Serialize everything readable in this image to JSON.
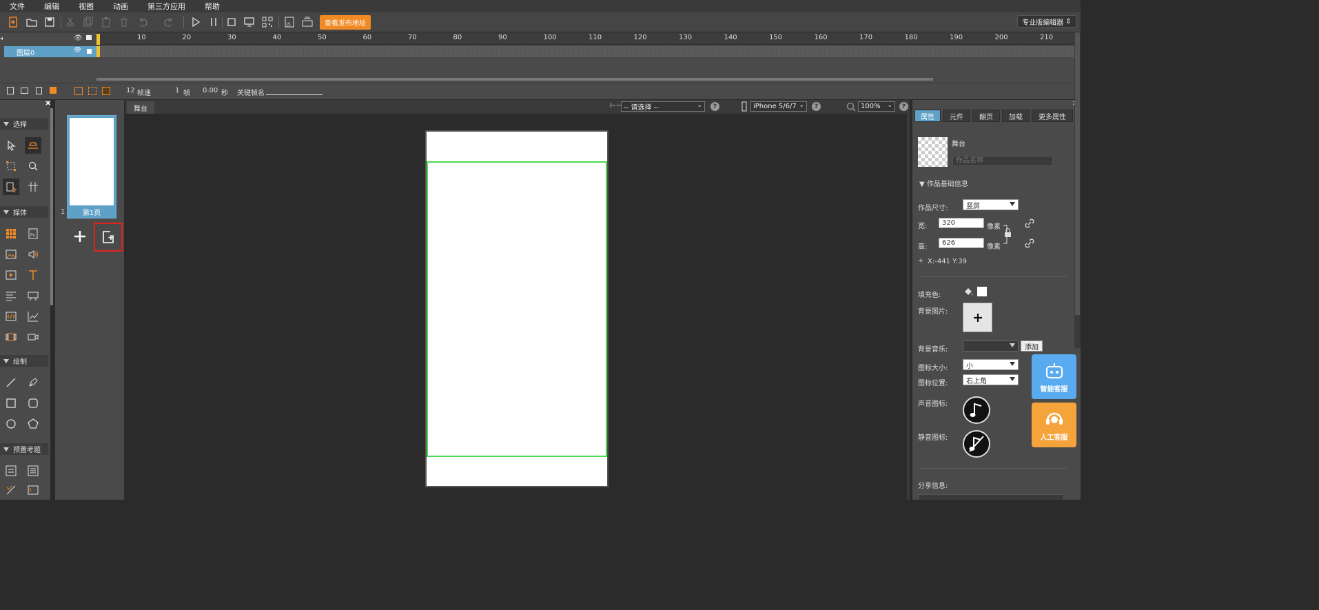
{
  "menu": [
    "文件",
    "编辑",
    "视图",
    "动画",
    "第三方应用",
    "帮助"
  ],
  "toolbar": {
    "publish_label": "查看发布地址",
    "editor_mode": "专业版编辑器"
  },
  "timeline": {
    "ruler_labels": [
      "10",
      "20",
      "30",
      "40",
      "50",
      "60",
      "70",
      "80",
      "90",
      "100",
      "110",
      "120",
      "130",
      "140",
      "150",
      "160",
      "170",
      "180",
      "190",
      "200",
      "210"
    ],
    "layer_name": "图层0",
    "fps_value": "12",
    "fps_label": "帧速",
    "frame_value": "1",
    "frame_label": "帧",
    "time_value": "0.00",
    "time_label": "秒",
    "keyframe_label": "关键帧名"
  },
  "tools": {
    "select_section": "选择",
    "media_section": "媒体",
    "draw_section": "绘制",
    "preset_section": "预置考题"
  },
  "pages": {
    "page_number": "1",
    "page_label": "第1页"
  },
  "stage": {
    "tab_label": "舞台",
    "align_select": "-- 请选择 --",
    "device_select": "iPhone 5/6/7",
    "zoom_select": "100%",
    "help": "?"
  },
  "props": {
    "tabs": [
      "属性",
      "元件",
      "翻页",
      "加载",
      "更多属性"
    ],
    "stage_title": "舞台",
    "name_placeholder": "作品名称",
    "basic_info": "作品基础信息",
    "size_label": "作品尺寸:",
    "size_value": "竖屏",
    "width_label": "宽:",
    "width_value": "320",
    "height_label": "高:",
    "height_value": "626",
    "unit": "像素",
    "coords": "X:-441    Y:39",
    "fill_label": "填充色:",
    "bg_image_label": "背景图片:",
    "bg_music_label": "背景音乐:",
    "add_label": "添加",
    "icon_size_label": "图标大小:",
    "icon_size_value": "小",
    "icon_pos_label": "图标位置:",
    "icon_pos_value": "右上角",
    "sound_icon_label": "声音图标:",
    "mute_icon_label": "静音图标:",
    "share_label": "分享信息:"
  },
  "support": {
    "smart": "智能客服",
    "human": "人工客服"
  },
  "colors": {
    "accent": "#f08a24",
    "selection": "#5fa0c7",
    "safe_zone": "#4cd84c",
    "highlight": "#e2231a",
    "smart_bg": "#5aaaf0",
    "human_bg": "#f5a33b"
  }
}
